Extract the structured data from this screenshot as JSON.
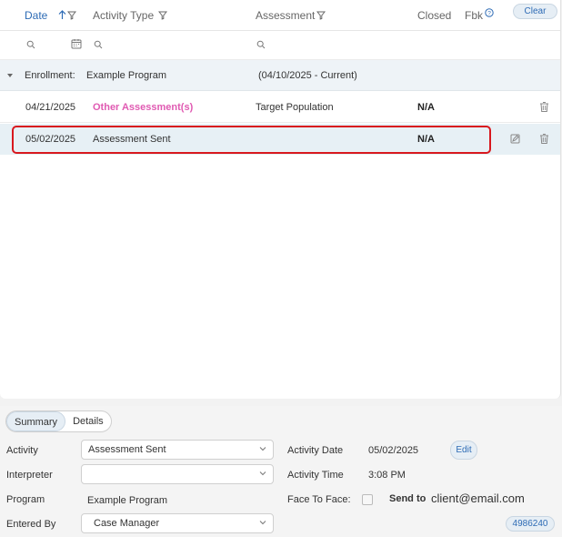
{
  "header": {
    "date": "Date",
    "activity_type": "Activity Type",
    "assessment": "Assessment",
    "closed": "Closed",
    "fbk": "Fbk",
    "clear": "Clear"
  },
  "group": {
    "label": "Enrollment:",
    "program": "Example Program",
    "range": "(04/10/2025 - Current)"
  },
  "rows": [
    {
      "date": "04/21/2025",
      "type": "Other Assessment(s)",
      "assessment": "Target Population",
      "closed": "N/A"
    },
    {
      "date": "05/02/2025",
      "type": "Assessment Sent",
      "assessment": "",
      "closed": "N/A"
    }
  ],
  "detail": {
    "tabs": [
      "Summary",
      "Details"
    ],
    "activity_label": "Activity",
    "activity_value": "Assessment Sent",
    "interpreter_label": "Interpreter",
    "interpreter_value": "",
    "program_label": "Program",
    "program_value": "Example Program",
    "entered_by_label": "Entered By",
    "entered_by_value": "Case Manager",
    "activity_date_label": "Activity Date",
    "activity_date_value": "05/02/2025",
    "edit_label": "Edit",
    "activity_time_label": "Activity Time",
    "activity_time_value": "3:08 PM",
    "face_to_face_label": "Face To Face:",
    "send_to_label": "Send to",
    "send_to_value": "client@email.com",
    "record_id": "4986240"
  },
  "colors": {
    "accent": "#2d6bb5",
    "highlight_border": "#d8181e",
    "pink_link": "#e05ab2"
  }
}
